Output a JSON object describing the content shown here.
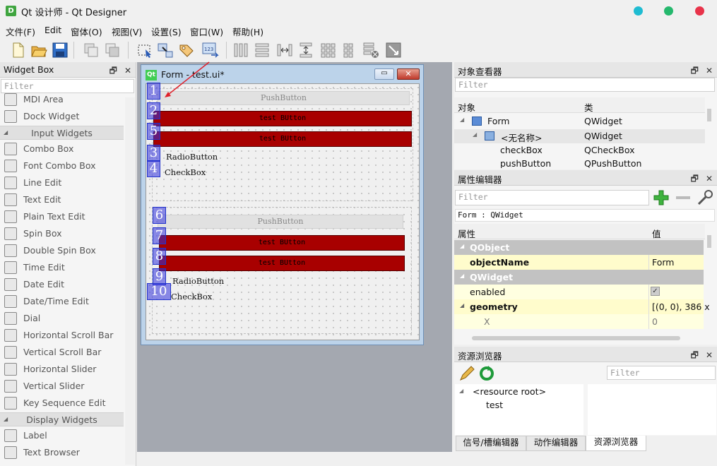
{
  "window": {
    "app_icon": "D",
    "title": "Qt 设计师 - Qt Designer"
  },
  "menu": [
    "文件(F)",
    "Edit",
    "窗体(O)",
    "视图(V)",
    "设置(S)",
    "窗口(W)",
    "帮助(H)"
  ],
  "toolbar_icons": [
    "new-file-icon",
    "open-folder-icon",
    "save-icon",
    "copy-window-icon",
    "paste-window-icon",
    "edit-widgets-icon",
    "edit-signals-icon",
    "edit-buddies-icon",
    "edit-tab-order-icon",
    "layout-horizontal-icon",
    "layout-vertical-icon",
    "splitter-horizontal-icon",
    "splitter-vertical-icon",
    "layout-grid-icon",
    "layout-form-icon",
    "break-layout-icon",
    "adjust-size-icon"
  ],
  "widget_box": {
    "title": "Widget Box",
    "filter_placeholder": "Filter",
    "items_top": [
      {
        "label": "MDI Area",
        "icon": "mdi-area-icon"
      },
      {
        "label": "Dock Widget",
        "icon": "dock-widget-icon"
      }
    ],
    "category_input": "Input Widgets",
    "input_items": [
      {
        "label": "Combo Box",
        "icon": "combo-box-icon"
      },
      {
        "label": "Font Combo Box",
        "icon": "font-combo-box-icon"
      },
      {
        "label": "Line Edit",
        "icon": "line-edit-icon"
      },
      {
        "label": "Text Edit",
        "icon": "text-edit-icon"
      },
      {
        "label": "Plain Text Edit",
        "icon": "plain-text-edit-icon"
      },
      {
        "label": "Spin Box",
        "icon": "spin-box-icon"
      },
      {
        "label": "Double Spin Box",
        "icon": "double-spin-box-icon"
      },
      {
        "label": "Time Edit",
        "icon": "time-edit-icon"
      },
      {
        "label": "Date Edit",
        "icon": "date-edit-icon"
      },
      {
        "label": "Date/Time Edit",
        "icon": "datetime-edit-icon"
      },
      {
        "label": "Dial",
        "icon": "dial-icon"
      },
      {
        "label": "Horizontal Scroll Bar",
        "icon": "hscrollbar-icon"
      },
      {
        "label": "Vertical Scroll Bar",
        "icon": "vscrollbar-icon"
      },
      {
        "label": "Horizontal Slider",
        "icon": "hslider-icon"
      },
      {
        "label": "Vertical Slider",
        "icon": "vslider-icon"
      },
      {
        "label": "Key Sequence Edit",
        "icon": "key-sequence-icon"
      }
    ],
    "category_display": "Display Widgets",
    "display_items": [
      {
        "label": "Label",
        "icon": "label-icon"
      },
      {
        "label": "Text Browser",
        "icon": "text-browser-icon"
      }
    ]
  },
  "form": {
    "title": "Form - test.ui*",
    "qt_badge": "Qt",
    "group1": {
      "pushbutton": "PushButton",
      "red1": "test BUtton",
      "red2": "test BUtton",
      "radio": "RadioButton",
      "check": "CheckBox"
    },
    "group2": {
      "pushbutton": "PushButton",
      "red1": "test BUtton",
      "red2": "test BUtton",
      "radio": "RadioButton",
      "check": "CheckBox"
    },
    "tab_order": [
      "1",
      "2",
      "5",
      "3",
      "4",
      "6",
      "7",
      "8",
      "9",
      "10"
    ]
  },
  "object_inspector": {
    "title": "对象查看器",
    "filter_placeholder": "Filter",
    "col_object": "对象",
    "col_class": "类",
    "rows": [
      {
        "object": "Form",
        "class": "QWidget"
      },
      {
        "object": "<无名称>",
        "class": "QWidget"
      },
      {
        "object": "checkBox",
        "class": "QCheckBox"
      },
      {
        "object": "pushButton",
        "class": "QPushButton"
      }
    ]
  },
  "property_editor": {
    "title": "属性编辑器",
    "filter_placeholder": "Filter",
    "context": "Form : QWidget",
    "col_property": "属性",
    "col_value": "值",
    "rows": [
      {
        "name": "QObject",
        "value": ""
      },
      {
        "name": "objectName",
        "value": "Form"
      },
      {
        "name": "QWidget",
        "value": ""
      },
      {
        "name": "enabled",
        "value": "✓"
      },
      {
        "name": "geometry",
        "value": "[(0, 0), 386 x"
      },
      {
        "name": "X",
        "value": "0"
      }
    ]
  },
  "resource_browser": {
    "title": "资源浏览器",
    "filter_placeholder": "Filter",
    "root": "<resource root>",
    "child": "test"
  },
  "bottom_tabs": [
    "信号/槽编辑器",
    "动作编辑器",
    "资源浏览器"
  ]
}
